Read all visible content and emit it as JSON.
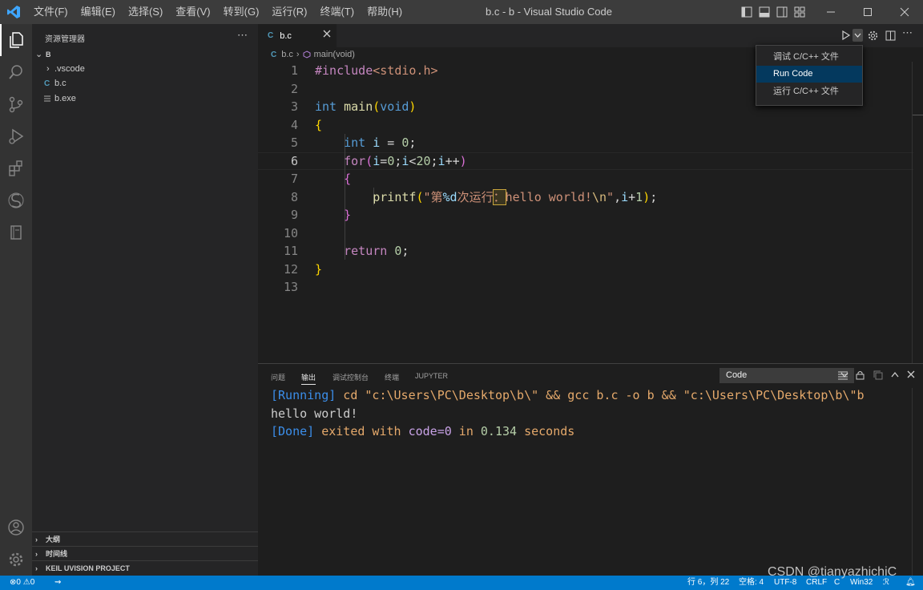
{
  "titlebar": {
    "menu": [
      "文件(F)",
      "编辑(E)",
      "选择(S)",
      "查看(V)",
      "转到(G)",
      "运行(R)",
      "终端(T)",
      "帮助(H)"
    ],
    "title": "b.c - b - Visual Studio Code"
  },
  "sidebar": {
    "header": "资源管理器",
    "folder": "B",
    "items": [
      ".vscode",
      "b.c",
      "b.exe"
    ],
    "sections": [
      "大纲",
      "时间线",
      "KEIL UVISION PROJECT"
    ]
  },
  "editor": {
    "tab_icon": "C",
    "tab_label": "b.c",
    "breadcrumb": {
      "file": "b.c",
      "symbol": "main(void)"
    },
    "line_numbers": [
      "1",
      "2",
      "3",
      "4",
      "5",
      "6",
      "7",
      "8",
      "9",
      "10",
      "11",
      "12",
      "13"
    ],
    "code": {
      "l1a": "#include",
      "l1b": "<stdio.h>",
      "l3a": "int",
      "l3b": "main",
      "l3c": "(",
      "l3d": "void",
      "l3e": ")",
      "l4": "{",
      "l5a": "int",
      "l5b": "i",
      "l5c": " = ",
      "l5d": "0",
      "l5e": ";",
      "l6a": "for",
      "l6b": "(",
      "l6c": "i",
      "l6d": "=",
      "l6e": "0",
      "l6f": ";",
      "l6g": "i",
      "l6h": "<",
      "l6i": "20",
      "l6j": ";",
      "l6k": "i",
      "l6l": "++",
      "l6m": ")",
      "l7": "{",
      "l8a": "printf",
      "l8b": "(",
      "l8c": "\"第",
      "l8d": "%d",
      "l8e": "次运行",
      "l8f": "：",
      "l8g": "hello world!",
      "l8h": "\\n",
      "l8i": "\"",
      ",": ",",
      "l8j": "i",
      "l8k": "+",
      "l8l": "1",
      "l8m": ")",
      "l8n": ";",
      "l9": "}",
      "l11a": "return",
      "l11b": "0",
      "l11c": ";",
      "l12": "}"
    }
  },
  "run_menu": {
    "items": [
      "调试 C/C++ 文件",
      "Run Code",
      "运行 C/C++ 文件"
    ],
    "selected": "Run Code"
  },
  "panel": {
    "tabs": [
      "问题",
      "输出",
      "调试控制台",
      "终端",
      "JUPYTER"
    ],
    "active_tab": "输出",
    "output_channel": "Code",
    "out1a": "[Running]",
    "out1b": " cd \"c:\\Users\\PC\\Desktop\\b\\\" && gcc b.c -o b && \"c:\\Users\\PC\\Desktop\\b\\\"b",
    "out2": "hello world!",
    "out3a": "[Done]",
    "out3b": " exited with ",
    "out3c": "code=0",
    "out3d": " in ",
    "out3e": "0.134",
    "out3f": " seconds"
  },
  "statusbar": {
    "errors": "0",
    "warnings": "0",
    "position": "行 6，列 22",
    "spaces": "空格: 4",
    "encoding": "UTF-8",
    "eol": "CRLF",
    "language": "C",
    "platform": "Win32"
  },
  "watermark": "CSDN @tianyazhichiC",
  "colors": {
    "accent": "#007acc",
    "editor_bg": "#1e1e1e",
    "sidebar_bg": "#252526",
    "titlebar_bg": "#3c3c3c",
    "activity_bg": "#333333"
  }
}
